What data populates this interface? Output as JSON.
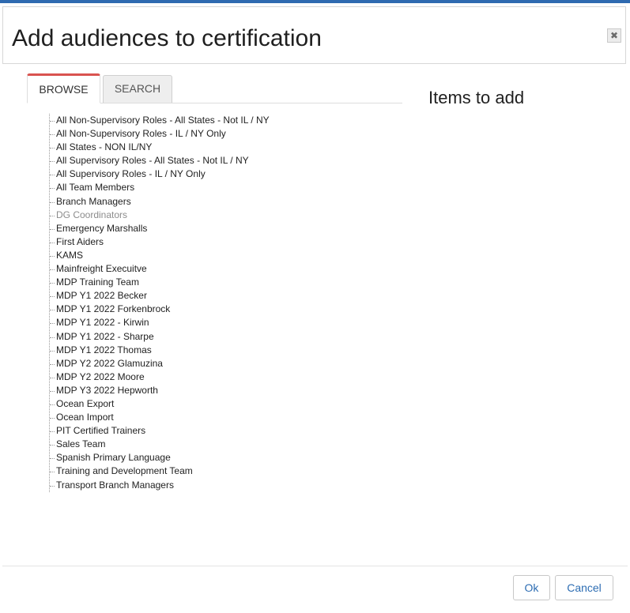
{
  "dialog": {
    "title": "Add audiences to certification",
    "close_icon": "close-icon"
  },
  "tabs": [
    {
      "label": "BROWSE",
      "active": true
    },
    {
      "label": "SEARCH",
      "active": false
    }
  ],
  "colors": {
    "active_tab_accent": "#d9534f",
    "top_bar": "#2f6ab0",
    "button_text": "#2d6db3",
    "disabled_item": "#8c8c8c"
  },
  "tree": {
    "items": [
      {
        "label": "All Non-Supervisory Roles - All States - Not IL / NY"
      },
      {
        "label": "All Non-Supervisory Roles - IL / NY Only"
      },
      {
        "label": "All States - NON IL/NY"
      },
      {
        "label": "All Supervisory Roles - All States - Not IL / NY"
      },
      {
        "label": "All Supervisory Roles - IL / NY Only"
      },
      {
        "label": "All Team Members"
      },
      {
        "label": "Branch Managers"
      },
      {
        "label": "DG Coordinators",
        "disabled": true
      },
      {
        "label": "Emergency Marshalls"
      },
      {
        "label": "First Aiders"
      },
      {
        "label": "KAMS"
      },
      {
        "label": "Mainfreight Execuitve"
      },
      {
        "label": "MDP Training Team"
      },
      {
        "label": "MDP Y1 2022 Becker"
      },
      {
        "label": "MDP Y1 2022 Forkenbrock"
      },
      {
        "label": "MDP Y1 2022 - Kirwin"
      },
      {
        "label": "MDP Y1 2022 - Sharpe"
      },
      {
        "label": "MDP Y1 2022 Thomas"
      },
      {
        "label": "MDP Y2 2022 Glamuzina"
      },
      {
        "label": "MDP Y2 2022 Moore"
      },
      {
        "label": "MDP Y3 2022 Hepworth"
      },
      {
        "label": "Ocean Export"
      },
      {
        "label": "Ocean Import"
      },
      {
        "label": "PIT Certified Trainers"
      },
      {
        "label": "Sales Team"
      },
      {
        "label": "Spanish Primary Language"
      },
      {
        "label": "Training and Development Team"
      },
      {
        "label": "Transport Branch Managers"
      }
    ]
  },
  "items_to_add": {
    "title": "Items to add"
  },
  "footer": {
    "ok_label": "Ok",
    "cancel_label": "Cancel"
  }
}
